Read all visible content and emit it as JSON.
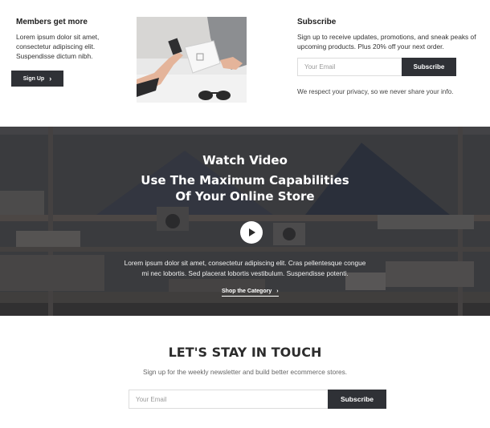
{
  "members": {
    "title": "Members get more",
    "body": "Lorem ipsum dolor sit amet, consectetur adipiscing elit. Suspendisse dictum nibh.",
    "button_label": "Sign Up",
    "button_icon": "chevron-right-icon"
  },
  "photo": {
    "icon": "card-payment-photo"
  },
  "subscribe": {
    "title": "Subscribe",
    "description": "Sign up to receive updates, promotions, and sneak peaks of upcoming products. Plus 20% off your next order.",
    "email_placeholder": "Your Email",
    "button_label": "Subscribe",
    "privacy": "We respect your privacy, so we never share your info."
  },
  "video": {
    "kicker": "Watch Video",
    "headline_line1": "Use The Maximum Capabilities",
    "headline_line2": "Of Your Online Store",
    "play_icon": "play-icon",
    "body": "Lorem ipsum dolor sit amet, consectetur adipiscing elit. Cras pellentesque congue mi nec lobortis. Sed placerat lobortis vestibulum. Suspendisse potenti.",
    "link_label": "Shop the Category",
    "link_icon": "chevron-right-icon"
  },
  "newsletter": {
    "title": "LET'S STAY IN TOUCH",
    "subtitle": "Sign up for the weekly newsletter and build better ecommerce stores.",
    "email_placeholder": "Your Email",
    "button_label": "Subscribe"
  },
  "colors": {
    "dark_button": "#2f3136",
    "banner_bg": "#3b3c3f",
    "text": "#222222"
  }
}
